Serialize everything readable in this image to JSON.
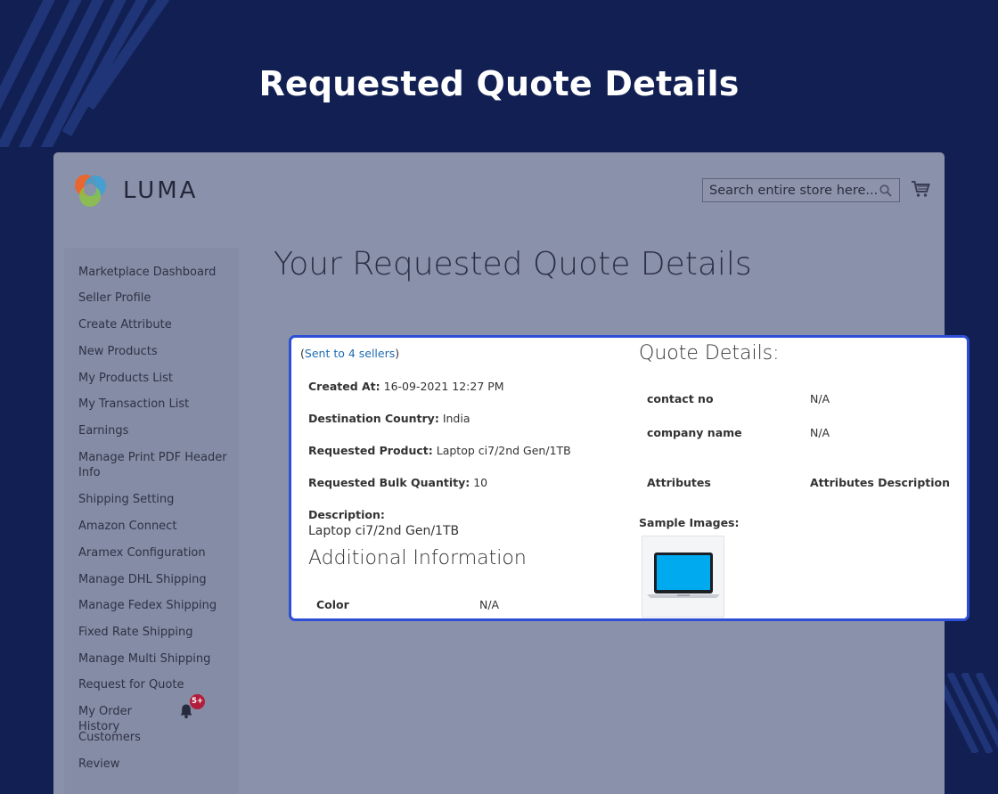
{
  "banner": {
    "title": "Requested Quote Details"
  },
  "header": {
    "logo_text": "LUMA",
    "search": {
      "placeholder": "Search entire store here..."
    }
  },
  "sidebar": {
    "items": [
      {
        "label": "Marketplace Dashboard"
      },
      {
        "label": "Seller Profile"
      },
      {
        "label": "Create Attribute"
      },
      {
        "label": "New Products"
      },
      {
        "label": "My Products List"
      },
      {
        "label": "My Transaction List"
      },
      {
        "label": "Earnings"
      },
      {
        "label": "Manage Print PDF Header Info"
      },
      {
        "label": "Shipping Setting"
      },
      {
        "label": "Amazon Connect"
      },
      {
        "label": "Aramex Configuration"
      },
      {
        "label": "Manage DHL Shipping"
      },
      {
        "label": "Manage Fedex Shipping"
      },
      {
        "label": "Fixed Rate Shipping"
      },
      {
        "label": "Manage Multi Shipping"
      },
      {
        "label": "Request for Quote"
      },
      {
        "label": "My Order History"
      },
      {
        "label": "Customers"
      },
      {
        "label": "Review"
      }
    ],
    "notification_badge": "5+"
  },
  "main": {
    "title": "Your Requested Quote Details"
  },
  "quote": {
    "sent_prefix": "(",
    "sent_link": "Sent to 4 sellers",
    "sent_suffix": ")",
    "created_at_label": "Created At:",
    "created_at": "16-09-2021 12:27 PM",
    "destination_label": "Destination Country:",
    "destination": "India",
    "product_label": "Requested Product:",
    "product": "Laptop ci7/2nd Gen/1TB",
    "qty_label": "Requested Bulk Quantity:",
    "qty": "10",
    "description_label": "Description:",
    "description": "Laptop ci7/2nd Gen/1TB",
    "additional_title": "Additional Information",
    "color_label": "Color",
    "color_value": "N/A",
    "details_title": "Quote Details:",
    "contact_label": "contact no",
    "contact_value": "N/A",
    "company_label": "company name",
    "company_value": "N/A",
    "attributes_label": "Attributes",
    "attributes_desc_label": "Attributes Description",
    "sample_images_label": "Sample Images:"
  },
  "colors": {
    "background": "#121f52",
    "card_border": "#2c4fd6",
    "link": "#1f6bb0",
    "badge": "#b21d3b",
    "sample_screen": "#00aaee"
  },
  "icons": [
    "luma-logo-icon",
    "search-icon",
    "cart-icon",
    "bell-icon",
    "laptop-icon"
  ]
}
